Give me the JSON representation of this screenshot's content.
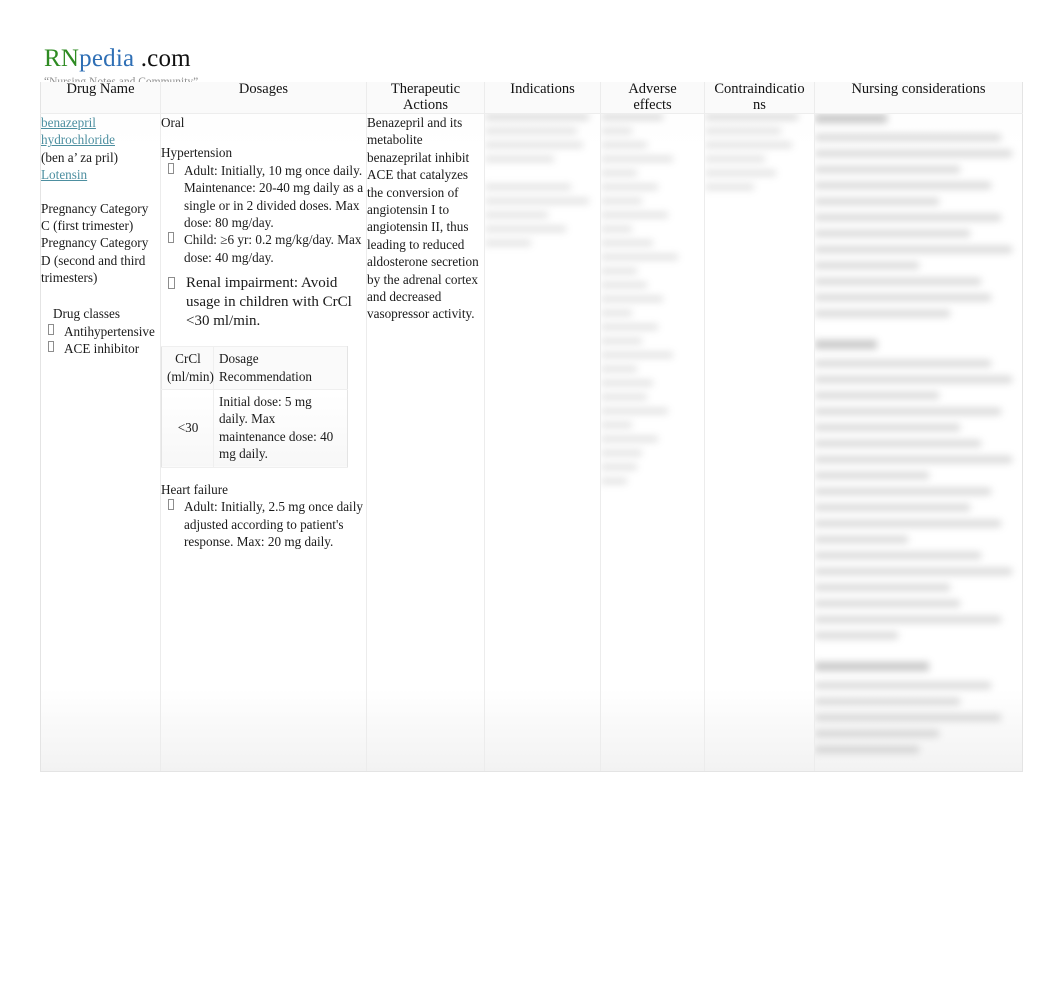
{
  "brand": {
    "logo_rn": "RN",
    "logo_pedia": "pedia",
    "logo_domain": ".com",
    "tagline": "“Nursing Notes and Community”",
    "color_rn": "#2e8b22",
    "color_pedia": "#2f6fb5",
    "color_link": "#4d8fa0"
  },
  "table": {
    "headers": [
      "Drug Name",
      "Dosages",
      "Therapeutic Actions",
      "Indications",
      "Adverse effects",
      "Contraindications",
      "Nursing considerations"
    ],
    "header_wrapped": {
      "therapeutic_line1": "Therapeutic",
      "therapeutic_line2": "Actions",
      "adverse_line1": "Adverse",
      "adverse_line2": "effects",
      "contra_line1": "Contraindicatio",
      "contra_line2": "ns"
    }
  },
  "drug_name": {
    "generic_line1": "benazepril",
    "generic_line2": "hydrochloride",
    "pronunciation": "(ben a’ za pril)",
    "brand": "Lotensin",
    "pregnancy_c": "Pregnancy Category C (first trimester)",
    "pregnancy_d": "Pregnancy Category D (second and third trimesters)",
    "drug_classes_label": "Drug classes",
    "drug_classes": [
      "Antihypertensive",
      "ACE inhibitor"
    ]
  },
  "dosages": {
    "route": "Oral",
    "section_hypertension": "Hypertension",
    "hypertension_items": [
      "Adult: Initially, 10 mg once daily. Maintenance: 20-40 mg daily as a single or in 2 divided doses. Max dose: 80 mg/day.",
      "Child: ≥6 yr: 0.2 mg/kg/day. Max dose: 40 mg/day."
    ],
    "renal_note": "Renal impairment: Avoid usage in children with CrCl <30 ml/min.",
    "crcl_table": {
      "headers": [
        "CrCl (ml/min)",
        "Dosage Recommendation"
      ],
      "rows": [
        {
          "crcl": "<30",
          "recommendation": "Initial dose: 5 mg daily. Max maintenance dose: 40 mg daily."
        }
      ]
    },
    "section_heart_failure": "Heart failure",
    "heart_failure_items": [
      "Adult: Initially, 2.5 mg once daily adjusted according to patient's response. Max: 20 mg daily."
    ]
  },
  "therapeutic_actions": {
    "text": "Benazepril and its metabolite benazeprilat inhibit ACE that catalyzes the conversion of angiotensin I to angiotensin II, thus leading to reduced aldosterone secretion by the adrenal cortex and decreased vasopressor activity."
  },
  "indications": {
    "text": "",
    "state": "blurred"
  },
  "adverse_effects": {
    "text": "",
    "state": "blurred"
  },
  "contraindications": {
    "text": "",
    "state": "blurred"
  },
  "nursing_considerations": {
    "text": "",
    "state": "blurred"
  }
}
